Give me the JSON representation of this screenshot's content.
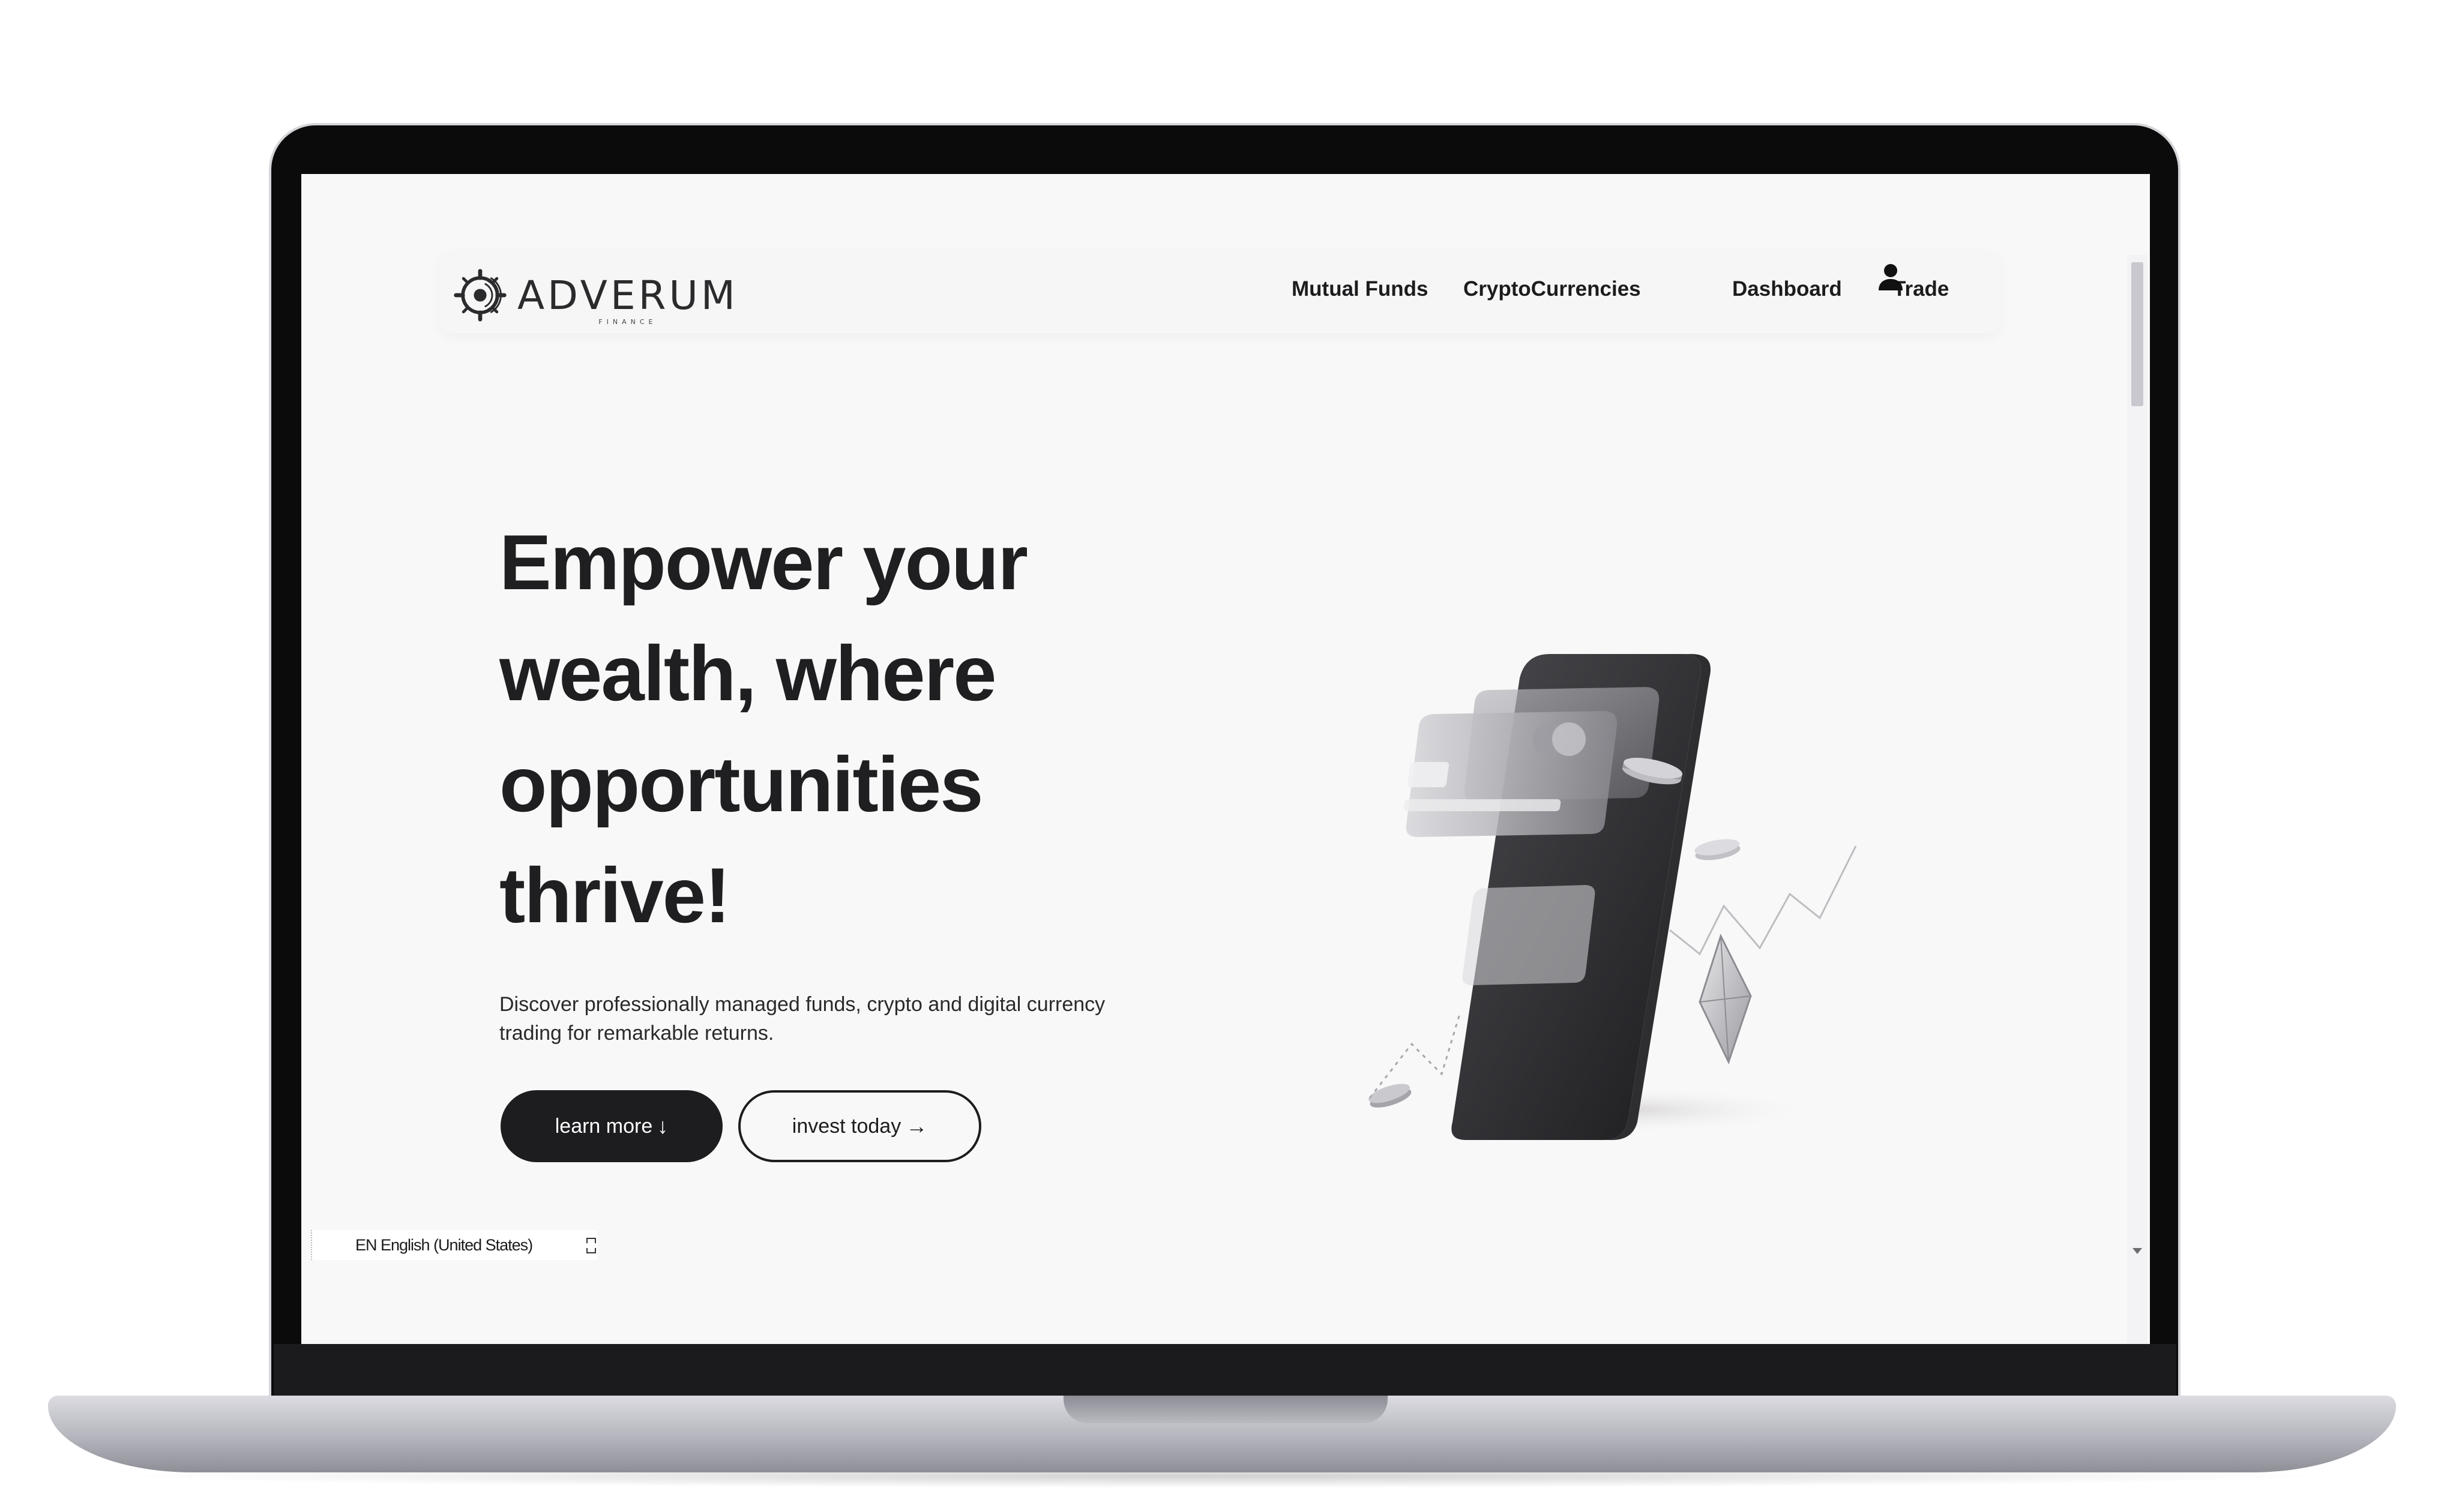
{
  "brand": {
    "name": "ADVERUM",
    "tagline": "FINANCE"
  },
  "nav": {
    "left_links": [
      "Mutual Funds",
      "CryptoCurrencies"
    ],
    "right_links": [
      "Dashboard",
      "Trade"
    ],
    "account_icon": "user-icon"
  },
  "hero": {
    "title_lines": [
      "Empower your",
      "wealth, where",
      "opportunities",
      "thrive!"
    ],
    "subtitle_lines": [
      "Discover professionally managed funds, crypto and digital currency",
      "trading for remarkable returns."
    ],
    "primary_button": {
      "label": "learn more",
      "icon": "arrow-down-icon"
    },
    "secondary_button": {
      "label": "invest today",
      "icon": "arrow-right-icon"
    }
  },
  "language_bar": {
    "label": "EN English (United States)"
  },
  "colors": {
    "page_background": "#f9f8f8",
    "text_dark": "#1d1d1f",
    "button_dark": "#1d1d1f",
    "button_text_light": "#ffffff"
  }
}
